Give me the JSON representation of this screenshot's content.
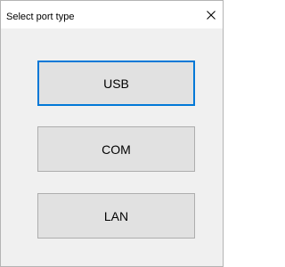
{
  "window": {
    "title": "Select port type",
    "close_icon": "close-icon"
  },
  "buttons": [
    {
      "label": "USB",
      "focused": true
    },
    {
      "label": "COM",
      "focused": false
    },
    {
      "label": "LAN",
      "focused": false
    }
  ],
  "colors": {
    "focus_border": "#0078d7",
    "button_face": "#e1e1e1",
    "button_border": "#adadad",
    "client_background": "#f0f0f0"
  }
}
